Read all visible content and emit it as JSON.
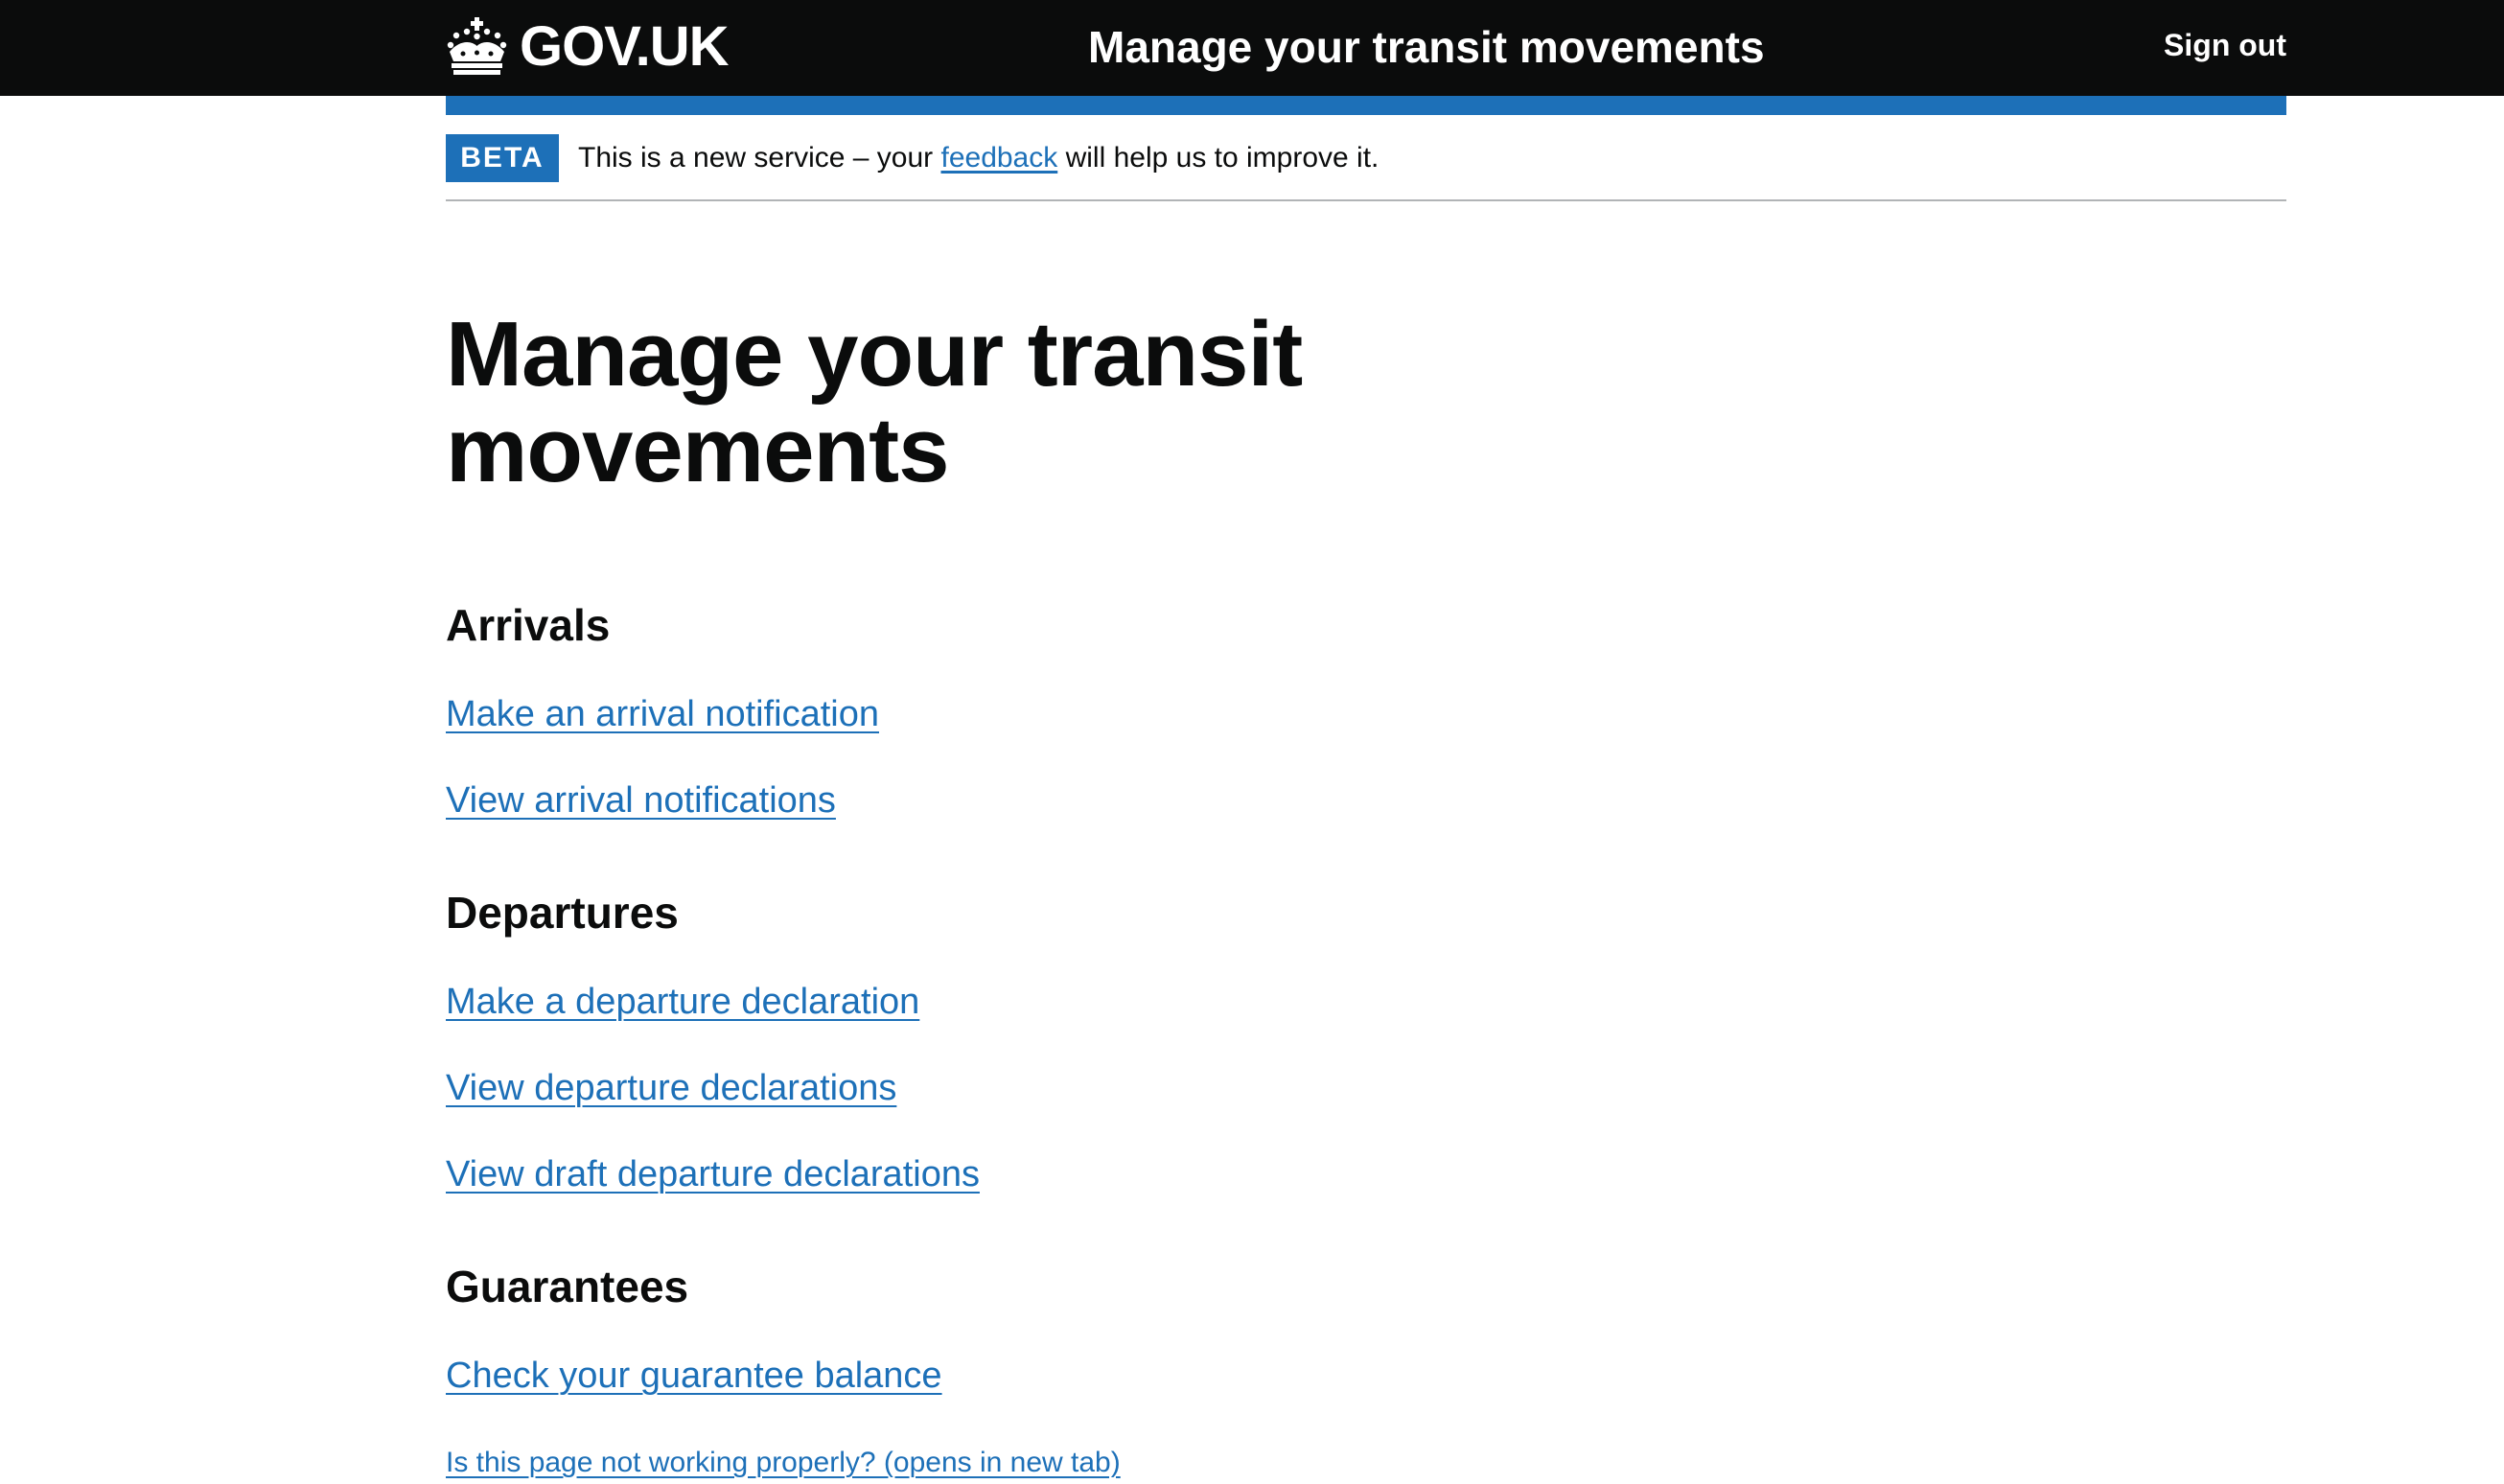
{
  "header": {
    "logo_text": "GOV.UK",
    "service_name": "Manage your transit movements",
    "sign_out_label": "Sign out"
  },
  "phase_banner": {
    "tag": "BETA",
    "text_before": "This is a new service – your",
    "link_text": "feedback",
    "text_after": "will help us to improve it."
  },
  "main": {
    "title": "Manage your transit movements",
    "sections": {
      "arrivals": {
        "heading": "Arrivals",
        "links": [
          "Make an arrival notification",
          "View arrival notifications"
        ]
      },
      "departures": {
        "heading": "Departures",
        "links": [
          "Make a departure declaration",
          "View departure declarations",
          "View draft departure declarations"
        ]
      },
      "guarantees": {
        "heading": "Guarantees",
        "links": [
          "Check your guarantee balance"
        ]
      }
    },
    "report_problem_link": "Is this page not working properly? (opens in new tab)"
  },
  "colors": {
    "header_background": "#0b0c0c",
    "brand_blue": "#1d70b8",
    "link": "#1d70b8",
    "text": "#0b0c0c",
    "border": "#b1b4b6"
  },
  "icons": {
    "logo": "crown-icon"
  }
}
